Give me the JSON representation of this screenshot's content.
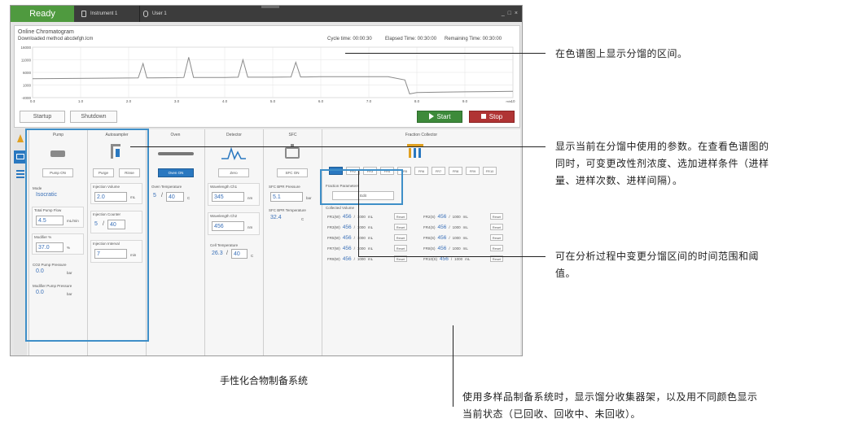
{
  "titlebar": {
    "status": "Ready",
    "instrument_tab": "Instrument 1",
    "user_tab": "User 1",
    "window_controls": "_ □ ×"
  },
  "chromatogram": {
    "title": "Online Chromatogram",
    "method": "Downloaded method abcdefgh.lcm",
    "cycle_time": "Cycle time: 00:00:30",
    "elapsed_time": "Elapsed Time: 00:30:00",
    "remaining_time": "Remaining Time: 00:30:00",
    "startup_label": "Startup",
    "shutdown_label": "Shutdown",
    "start_label": "Start",
    "stop_label": "Stop",
    "colors": {
      "start": "#3d8a3a",
      "stop": "#b03434",
      "trace": "#8a8a8a"
    }
  },
  "chart_data": {
    "type": "line",
    "x_ticks": [
      "0.0",
      "1.0",
      "2.0",
      "3.0",
      "4.0",
      "5.0",
      "6.0",
      "7.0",
      "8.0",
      "9.0",
      "10"
    ],
    "x_unit": "min",
    "y_ticks": [
      "16000",
      "11000",
      "6000",
      "1000",
      "-4000"
    ],
    "xlim": [
      0,
      10
    ],
    "ylim": [
      -4000,
      16000
    ],
    "series": [
      {
        "x": [
          0.0,
          1.5,
          2.2,
          2.3,
          2.38,
          2.5,
          3.0,
          3.15,
          3.25,
          3.35,
          3.5,
          4.0,
          4.28,
          4.38,
          4.48,
          4.6,
          5.0,
          5.38,
          5.48,
          5.58,
          5.7,
          6.0,
          6.8,
          7.0,
          7.4,
          7.75,
          7.85,
          8.0,
          8.5,
          9.0,
          9.5,
          10.0
        ],
        "y": [
          3500,
          3700,
          3800,
          9500,
          3800,
          3800,
          3900,
          4000,
          12000,
          4000,
          4000,
          4000,
          4100,
          11000,
          4100,
          4100,
          4100,
          4200,
          10000,
          4200,
          4200,
          4300,
          4300,
          4300,
          4300,
          3000,
          -2500,
          -2000,
          -1800,
          -1700,
          -1600,
          -1500
        ]
      }
    ],
    "grid": true
  },
  "sidebar": {
    "icons": [
      "flask-icon",
      "monitor-icon",
      "list-icon"
    ]
  },
  "pump": {
    "title": "Pump",
    "btn": "Pump ON",
    "mode_label": "Mode",
    "mode_value": "Isocratic",
    "flow_label": "Total Pump Flow",
    "flow_value": "4.5",
    "flow_unit": "mL/min",
    "modifier_label": "Modifier %",
    "modifier_value": "37.0",
    "modifier_unit": "%",
    "co2_label": "CO2 Pump Pressure",
    "co2_value": "0.0",
    "co2_unit": "bar",
    "modpump_label": "Modifier Pump Pressure",
    "modpump_value": "0.0",
    "modpump_unit": "bar"
  },
  "autosampler": {
    "title": "Autosampler",
    "purge": "Purge",
    "rinse": "Rinse",
    "vol_label": "Injection Volume",
    "vol_value": "2.0",
    "vol_unit": "mL",
    "counter_label": "Injection Counter",
    "counter_cur": "5",
    "counter_sep": "/",
    "counter_total": "40",
    "interval_label": "Injection Interval",
    "interval_value": "7",
    "interval_unit": "min"
  },
  "oven": {
    "title": "Oven",
    "btn": "Oven ON",
    "temp_label": "Oven Temperature",
    "temp_cur": "5",
    "temp_sep": "/",
    "temp_set": "40",
    "temp_unit": "C"
  },
  "detector": {
    "title": "Detector",
    "btn": "Zero",
    "wl1_label": "Wavelength Ch1",
    "wl1_value": "345",
    "wl1_unit": "nm",
    "wl2_label": "Wavelength Ch2",
    "wl2_value": "456",
    "wl2_unit": "nm",
    "cell_label": "Cell Temperature",
    "cell_cur": "26.3",
    "cell_sep": "/",
    "cell_set": "40",
    "cell_unit": "C"
  },
  "sfc": {
    "title": "SFC",
    "btn": "SFC ON",
    "bpr_label": "SFC BPR Pressure",
    "bpr_value": "5.1",
    "bpr_unit": "bar",
    "bprt_label": "SFC BPR Temperature",
    "bprt_value": "32.4",
    "bprt_unit": "C"
  },
  "fraction": {
    "title": "Fraction Collector",
    "tabs": [
      "FR1",
      "FR2",
      "FR3",
      "FR4",
      "FR5",
      "FR6",
      "FR7",
      "FR8",
      "FR9",
      "FR10"
    ],
    "params_label": "Fraction Parameters",
    "params_btn": "Edit",
    "collected_label": "Collected Volume",
    "rows": [
      {
        "name": "FR1(W)",
        "value": "456",
        "total": "1000",
        "unit": "mL",
        "reset": "Reset"
      },
      {
        "name": "FR2(S)",
        "value": "456",
        "total": "1000",
        "unit": "mL",
        "reset": "Reset"
      },
      {
        "name": "FR3(W)",
        "value": "456",
        "total": "1000",
        "unit": "mL",
        "reset": "Reset"
      },
      {
        "name": "FR4(S)",
        "value": "456",
        "total": "1000",
        "unit": "mL",
        "reset": "Reset"
      },
      {
        "name": "FR5(W)",
        "value": "456",
        "total": "1000",
        "unit": "mL",
        "reset": "Reset"
      },
      {
        "name": "FR6(S)",
        "value": "456",
        "total": "1000",
        "unit": "mL",
        "reset": "Reset"
      },
      {
        "name": "FR7(W)",
        "value": "456",
        "total": "1000",
        "unit": "mL",
        "reset": "Reset"
      },
      {
        "name": "FR8(S)",
        "value": "456",
        "total": "1000",
        "unit": "mL",
        "reset": "Reset"
      },
      {
        "name": "FR9(W)",
        "value": "456",
        "total": "1000",
        "unit": "mL",
        "reset": "Reset"
      },
      {
        "name": "FR10(S)",
        "value": "456",
        "total": "1000",
        "unit": "mL",
        "reset": "Reset"
      }
    ]
  },
  "annotations": {
    "a1": "在色谱图上显示分馏的区间。",
    "a2_l1": "显示当前在分馏中使用的参数。在查看色谱图的",
    "a2_l2": "同时，可变更改性剂浓度、选加进样条件（进样",
    "a2_l3": "量、进样次数、进样间隔）。",
    "a3_l1": "可在分析过程中变更分馏区间的时间范围和阈",
    "a3_l2": "值。",
    "a4_l1": "使用多样品制备系统时，显示馏分收集器架，以及用不同颜色显示",
    "a4_l2": "当前状态（已回收、回收中、未回收）。",
    "caption": "手性化合物制备系统"
  }
}
